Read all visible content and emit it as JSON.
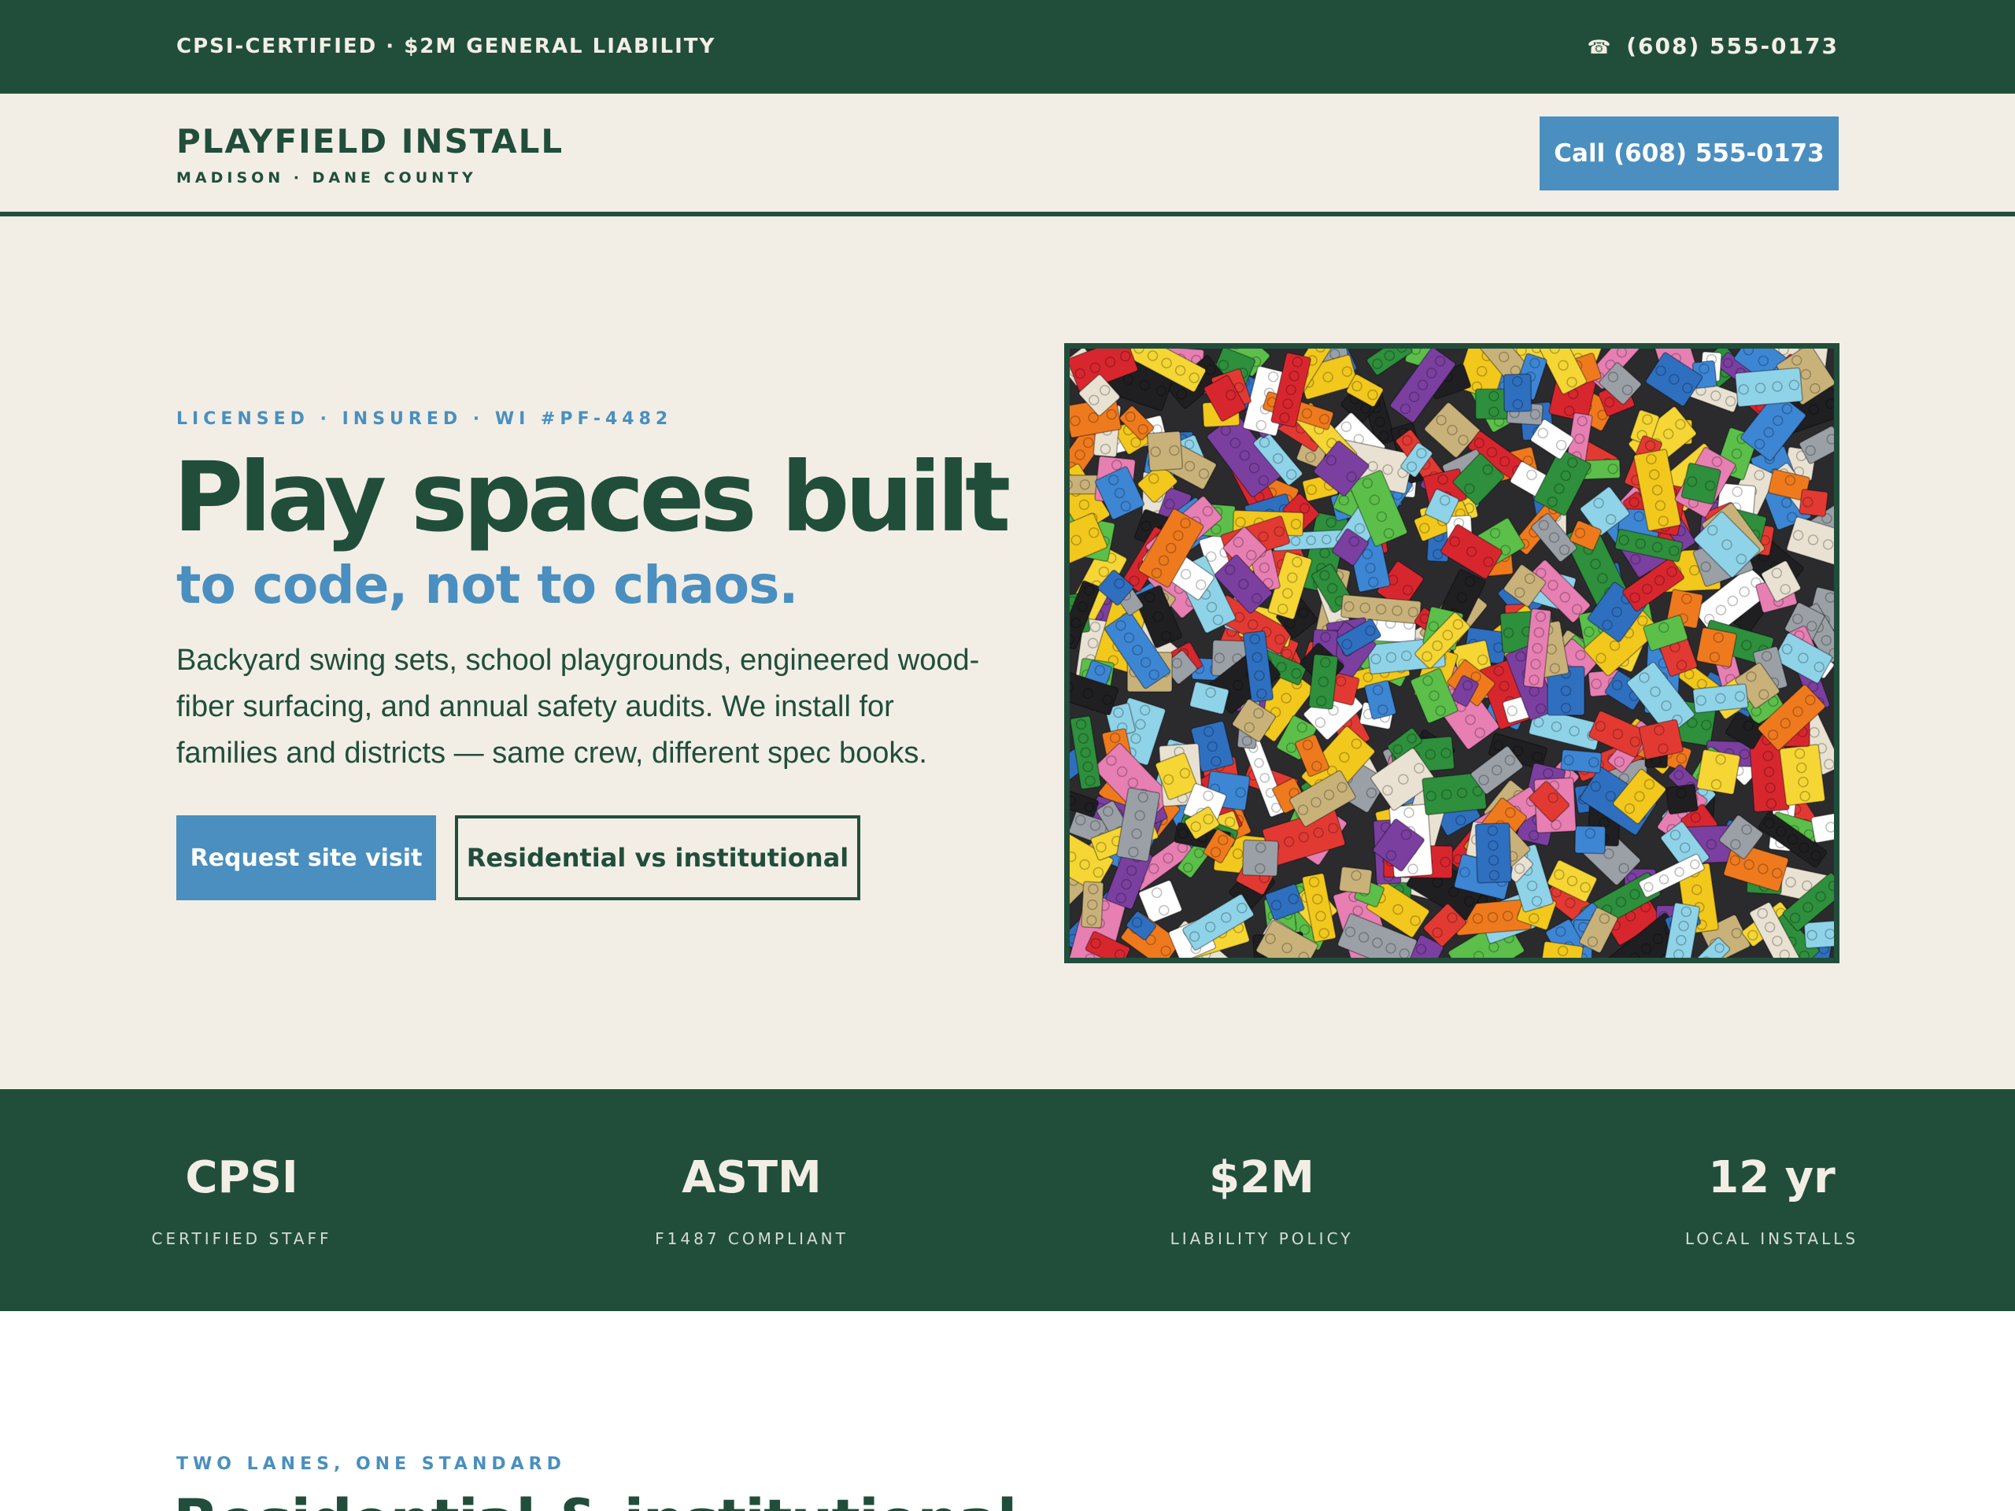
{
  "topbar": {
    "credentials": "CPSI-CERTIFIED · $2M GENERAL LIABILITY",
    "phone_icon": "☎",
    "phone": "(608) 555-0173"
  },
  "header": {
    "brand": "PLAYFIELD INSTALL",
    "brand_sub": "MADISON · DANE COUNTY",
    "call_button": "Call (608) 555-0173"
  },
  "hero": {
    "eyebrow": "LICENSED · INSURED · WI #PF-4482",
    "title": "Play spaces built",
    "subtitle": "to code, not to chaos.",
    "body": "Backyard swing sets, school playgrounds, engineered wood-fiber surfacing, and annual safety audits. We install for families and districts — same crew, different spec books.",
    "primary_button": "Request site visit",
    "secondary_button": "Residential vs institutional",
    "image_subject": "colorful plastic building bricks"
  },
  "stats": [
    {
      "value": "CPSI",
      "label": "CERTIFIED STAFF"
    },
    {
      "value": "ASTM",
      "label": "F1487 COMPLIANT"
    },
    {
      "value": "$2M",
      "label": "LIABILITY POLICY"
    },
    {
      "value": "12 yr",
      "label": "LOCAL INSTALLS"
    }
  ],
  "next_section": {
    "eyebrow": "TWO LANES, ONE STANDARD",
    "title": "Residential & institutional"
  },
  "colors": {
    "forest": "#214e3b",
    "cream": "#f2eee6",
    "accent_blue": "#4a8fbf",
    "white": "#ffffff"
  }
}
